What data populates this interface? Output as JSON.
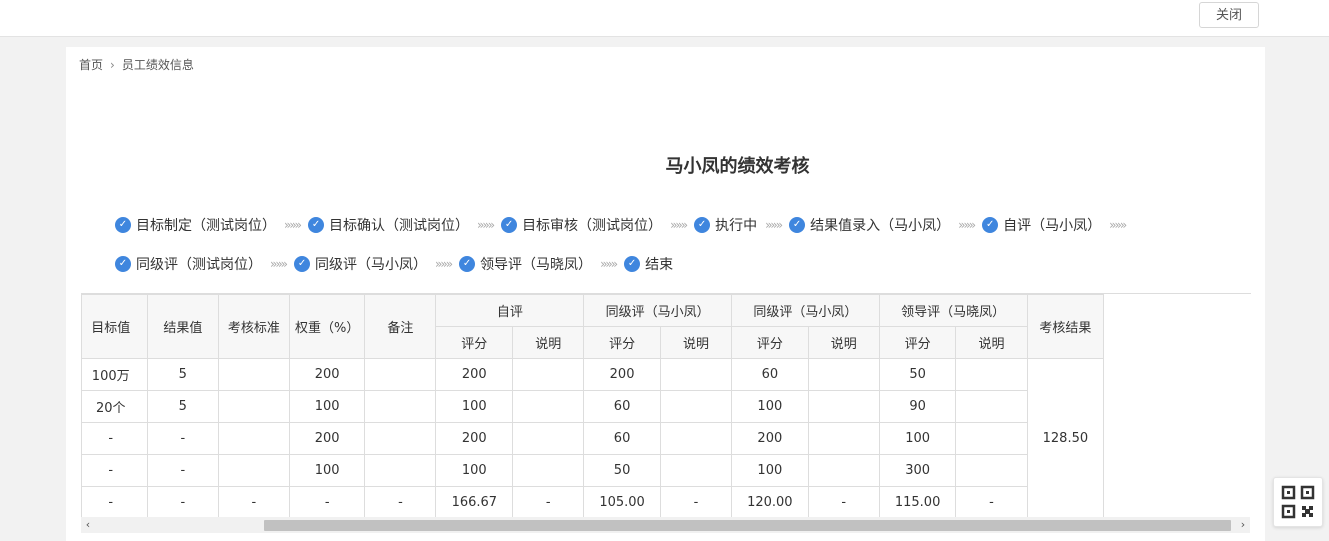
{
  "header": {
    "close_label": "关闭"
  },
  "breadcrumb": {
    "home": "首页",
    "current": "员工绩效信息"
  },
  "page": {
    "title": "马小凤的绩效考核"
  },
  "steps_row1": [
    {
      "label": "目标制定（测试岗位）"
    },
    {
      "label": "目标确认（测试岗位）"
    },
    {
      "label": "目标审核（测试岗位）"
    },
    {
      "label": "执行中"
    },
    {
      "label": "结果值录入（马小凤）"
    },
    {
      "label": "自评（马小凤）"
    }
  ],
  "steps_row2": [
    {
      "label": "同级评（测试岗位）"
    },
    {
      "label": "同级评（马小凤）"
    },
    {
      "label": "领导评（马晓凤）"
    },
    {
      "label": "结束"
    }
  ],
  "icons": {
    "step_done": "check-circle-icon",
    "qr": "qr-code-icon",
    "arrow_sep": "triple-chevron-right-icon"
  },
  "colors": {
    "accent": "#3f86de"
  },
  "table": {
    "headers": {
      "target": "目标值",
      "result": "结果值",
      "standard": "考核标准",
      "weight": "权重（%）",
      "remark": "备注",
      "self": "自评",
      "peer1": "同级评（马小凤）",
      "peer2": "同级评（马小凤）",
      "leader": "领导评（马晓凤）",
      "final": "考核结果",
      "score": "评分",
      "note": "说明"
    },
    "rows": [
      {
        "target": "100万",
        "result": "5",
        "standard": "",
        "weight": "200",
        "remark": "",
        "s1": "200",
        "n1": "",
        "s2": "200",
        "n2": "",
        "s3": "60",
        "n3": "",
        "s4": "50",
        "n4": ""
      },
      {
        "target": "20个",
        "result": "5",
        "standard": "",
        "weight": "100",
        "remark": "",
        "s1": "100",
        "n1": "",
        "s2": "60",
        "n2": "",
        "s3": "100",
        "n3": "",
        "s4": "90",
        "n4": ""
      },
      {
        "target": "-",
        "result": "-",
        "standard": "",
        "weight": "200",
        "remark": "",
        "s1": "200",
        "n1": "",
        "s2": "60",
        "n2": "",
        "s3": "200",
        "n3": "",
        "s4": "100",
        "n4": ""
      },
      {
        "target": "-",
        "result": "-",
        "standard": "",
        "weight": "100",
        "remark": "",
        "s1": "100",
        "n1": "",
        "s2": "50",
        "n2": "",
        "s3": "100",
        "n3": "",
        "s4": "300",
        "n4": ""
      },
      {
        "target": "-",
        "result": "-",
        "standard": "-",
        "weight": "-",
        "remark": "-",
        "s1": "166.67",
        "n1": "-",
        "s2": "105.00",
        "n2": "-",
        "s3": "120.00",
        "n3": "-",
        "s4": "115.00",
        "n4": "-"
      }
    ],
    "final_result": "128.50"
  }
}
